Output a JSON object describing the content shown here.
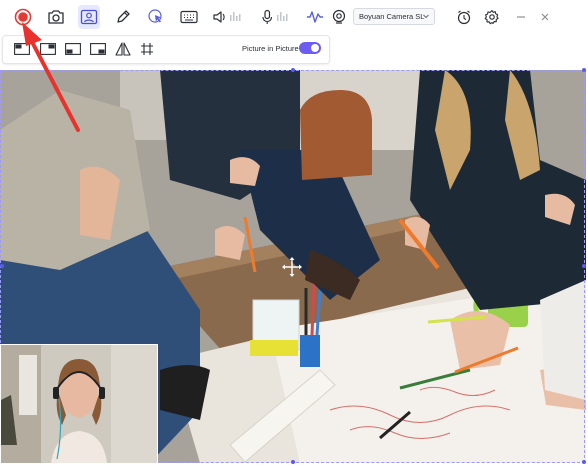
{
  "toolbar": {
    "camera_select_value": "Boyuan Camera SL",
    "items": [
      {
        "name": "record-button",
        "icon": "record-icon"
      },
      {
        "name": "screenshot-button",
        "icon": "camera-icon"
      },
      {
        "name": "webcam-button",
        "icon": "webcam-portrait-icon",
        "active": true
      },
      {
        "name": "pen-button",
        "icon": "pen-icon"
      },
      {
        "name": "cursor-effects-button",
        "icon": "cursor-click-icon"
      },
      {
        "name": "keyboard-button",
        "icon": "keyboard-icon"
      },
      {
        "name": "speaker-button",
        "icon": "speaker-icon"
      },
      {
        "name": "microphone-button",
        "icon": "microphone-icon"
      },
      {
        "name": "audio-effects-button",
        "icon": "waveform-icon"
      },
      {
        "name": "camera-toggle-button",
        "icon": "webcam-icon"
      },
      {
        "name": "timer-button",
        "icon": "alarm-clock-icon"
      },
      {
        "name": "settings-button",
        "icon": "gear-icon"
      },
      {
        "name": "minimize-button",
        "icon": "minimize-icon"
      },
      {
        "name": "close-button",
        "icon": "close-icon"
      }
    ]
  },
  "subbar": {
    "pip_label": "Picture in Picture",
    "pip_enabled": true,
    "layouts": [
      "layout-top-left-icon",
      "layout-top-right-icon",
      "layout-bottom-left-icon",
      "layout-bottom-right-icon",
      "flip-icon",
      "crop-grid-icon"
    ]
  },
  "colors": {
    "accent": "#6c5cf2",
    "record": "#e53935",
    "arrow": "#e8322b"
  }
}
